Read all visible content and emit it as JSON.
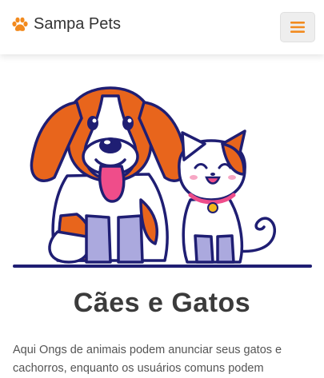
{
  "navbar": {
    "brand_icon": "paw-icon",
    "brand_text": "Sampa Pets",
    "menu_icon": "hamburger-menu-icon"
  },
  "hero": {
    "image": "dog-and-cat-illustration"
  },
  "main": {
    "title": "Cães e Gatos",
    "description": "Aqui Ongs de animais podem anunciar seus gatos e cachorros, enquanto os usuários comuns podem"
  },
  "colors": {
    "accent": "#f28a1e",
    "orange_fur": "#e8651c",
    "outline": "#1f1e73",
    "lavender": "#aba9de",
    "tongue": "#ef4d8a"
  }
}
